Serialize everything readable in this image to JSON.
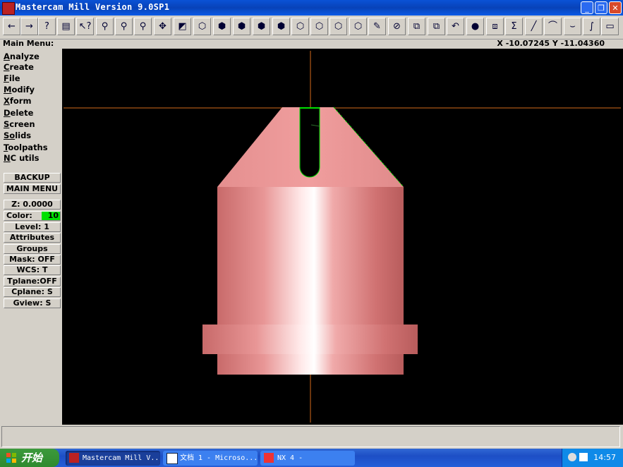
{
  "window": {
    "title": "Mastercam Mill Version 9.0SP1",
    "buttons": {
      "minimize": "_",
      "restore": "❐",
      "close": "✕"
    }
  },
  "toolbar": {
    "icons": [
      {
        "name": "back-arrow-icon",
        "glyph": "←"
      },
      {
        "name": "forward-arrow-icon",
        "glyph": "→"
      },
      {
        "name": "help-icon",
        "glyph": "?"
      },
      {
        "name": "file-cabinet-icon",
        "glyph": "▤"
      },
      {
        "name": "context-help-icon",
        "glyph": "↖?"
      },
      {
        "name": "zoom-window-icon",
        "glyph": "⚲"
      },
      {
        "name": "zoom-icon",
        "glyph": "⚲"
      },
      {
        "name": "zoom-fit-icon",
        "glyph": "⚲"
      },
      {
        "name": "pan-icon",
        "glyph": "✥"
      },
      {
        "name": "select-window-icon",
        "glyph": "◩"
      },
      {
        "name": "rotate-cube-icon",
        "glyph": "⬡"
      },
      {
        "name": "cube-top-icon",
        "glyph": "⬢"
      },
      {
        "name": "cube-front-icon",
        "glyph": "⬢"
      },
      {
        "name": "cube-side-icon",
        "glyph": "⬢"
      },
      {
        "name": "cube-iso-icon",
        "glyph": "⬢"
      },
      {
        "name": "cube-blue-1-icon",
        "glyph": "⬡"
      },
      {
        "name": "cube-blue-2-icon",
        "glyph": "⬡"
      },
      {
        "name": "cube-blue-3-icon",
        "glyph": "⬡"
      },
      {
        "name": "cube-blue-4-icon",
        "glyph": "⬡"
      },
      {
        "name": "pencil-icon",
        "glyph": "✎"
      },
      {
        "name": "no-entry-icon",
        "glyph": "⊘"
      },
      {
        "name": "arrange-icon",
        "glyph": "⧉"
      },
      {
        "name": "layers-icon",
        "glyph": "⧉"
      },
      {
        "name": "undo-icon",
        "glyph": "↶"
      },
      {
        "name": "sphere-icon",
        "glyph": "●"
      },
      {
        "name": "transform-icon",
        "glyph": "⧈"
      },
      {
        "name": "sigma-icon",
        "glyph": "Σ"
      },
      {
        "name": "line-icon",
        "glyph": "╱"
      },
      {
        "name": "arc-icon",
        "glyph": "⌒"
      },
      {
        "name": "fillet-icon",
        "glyph": "⌣"
      },
      {
        "name": "spline-icon",
        "glyph": "∫"
      },
      {
        "name": "rectangle-icon",
        "glyph": "▭"
      }
    ]
  },
  "status": {
    "main_menu_label": "Main Menu:",
    "coords": "X -10.07245  Y -11.04360"
  },
  "sidebar": {
    "menu": [
      {
        "hot": "A",
        "rest": "nalyze"
      },
      {
        "hot": "C",
        "rest": "reate"
      },
      {
        "hot": "F",
        "rest": "ile"
      },
      {
        "hot": "M",
        "rest": "odify"
      },
      {
        "hot": "X",
        "rest": "form"
      },
      {
        "hot": "D",
        "rest": "elete"
      },
      {
        "hot": "S",
        "rest": "creen"
      },
      {
        "hot": "So",
        "rest": "lids"
      },
      {
        "hot": "T",
        "rest": "oolpaths"
      },
      {
        "hot": "N",
        "rest": "C utils"
      }
    ],
    "backup": "BACKUP",
    "main_menu": "MAIN MENU",
    "z": "Z:  0.0000",
    "color_label": "Color:",
    "color_value": "10",
    "level": "Level:  1",
    "attributes": "Attributes",
    "groups": "Groups",
    "mask": "Mask:  OFF",
    "wcs": "WCS:  T",
    "tplane": "Tplane:OFF",
    "cplane": "Cplane:  S",
    "gview": "Gview:  S"
  },
  "colors": {
    "part": "#e08a8a",
    "highlight": "#ffffff",
    "axis": "#d36a1a",
    "edge": "#00e000"
  },
  "taskbar": {
    "start": "开始",
    "tasks": [
      {
        "label": "Mastercam Mill V...",
        "active": true
      },
      {
        "label": "文档 1 - Microso...",
        "active": false
      },
      {
        "label": "NX 4 -",
        "active": false
      }
    ],
    "clock": "14:57"
  }
}
